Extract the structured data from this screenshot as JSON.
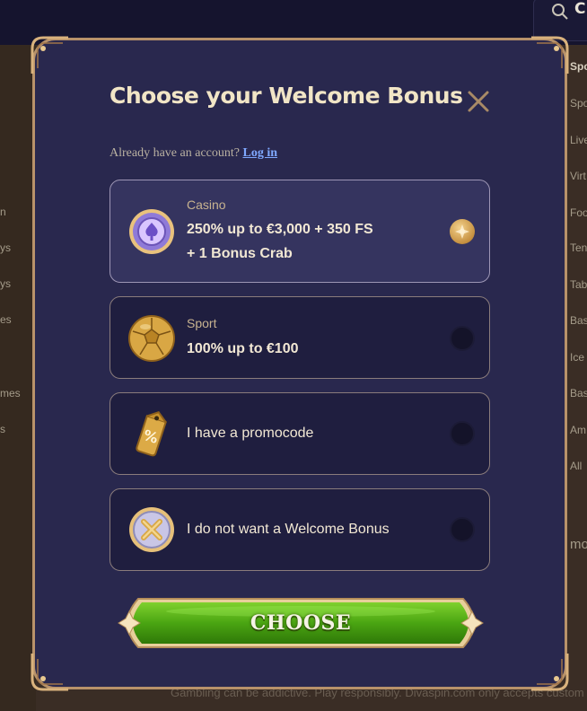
{
  "background": {
    "search_glyph": "C",
    "left_items": [
      "n",
      "ys",
      "ys",
      "es",
      "mes",
      "s"
    ],
    "right_items": [
      "Spo",
      "Spo",
      "Live",
      "Virt",
      "Foo",
      "Ten",
      "Tab",
      "Bas",
      "Ice",
      "Bas",
      "Am",
      "All",
      "mo"
    ],
    "footer": "Gambling can be addictive. Play responsibly. Divaspin.com only accepts custom"
  },
  "modal": {
    "title": "Choose your Welcome Bonus",
    "login_prompt": "Already have an account?",
    "login_link": "Log in",
    "options": [
      {
        "category": "Casino",
        "line1": "250% up to €3,000 + 350 FS",
        "line2": "+ 1 Bonus Crab",
        "icon": "casino-chip-icon",
        "selected": true
      },
      {
        "category": "Sport",
        "line1": "100% up to €100",
        "icon": "football-icon",
        "selected": false
      },
      {
        "label": "I have a promocode",
        "icon": "promo-tag-icon",
        "selected": false
      },
      {
        "label": "I do not want a Welcome Bonus",
        "icon": "no-bonus-icon",
        "selected": false
      }
    ],
    "choose_label": "CHOOSE"
  },
  "colors": {
    "modal_bg": "#29284e",
    "gold_border": "#b8926a",
    "title": "#f1e5c6",
    "link": "#7fa8ff",
    "button_green": "#4caf14"
  }
}
